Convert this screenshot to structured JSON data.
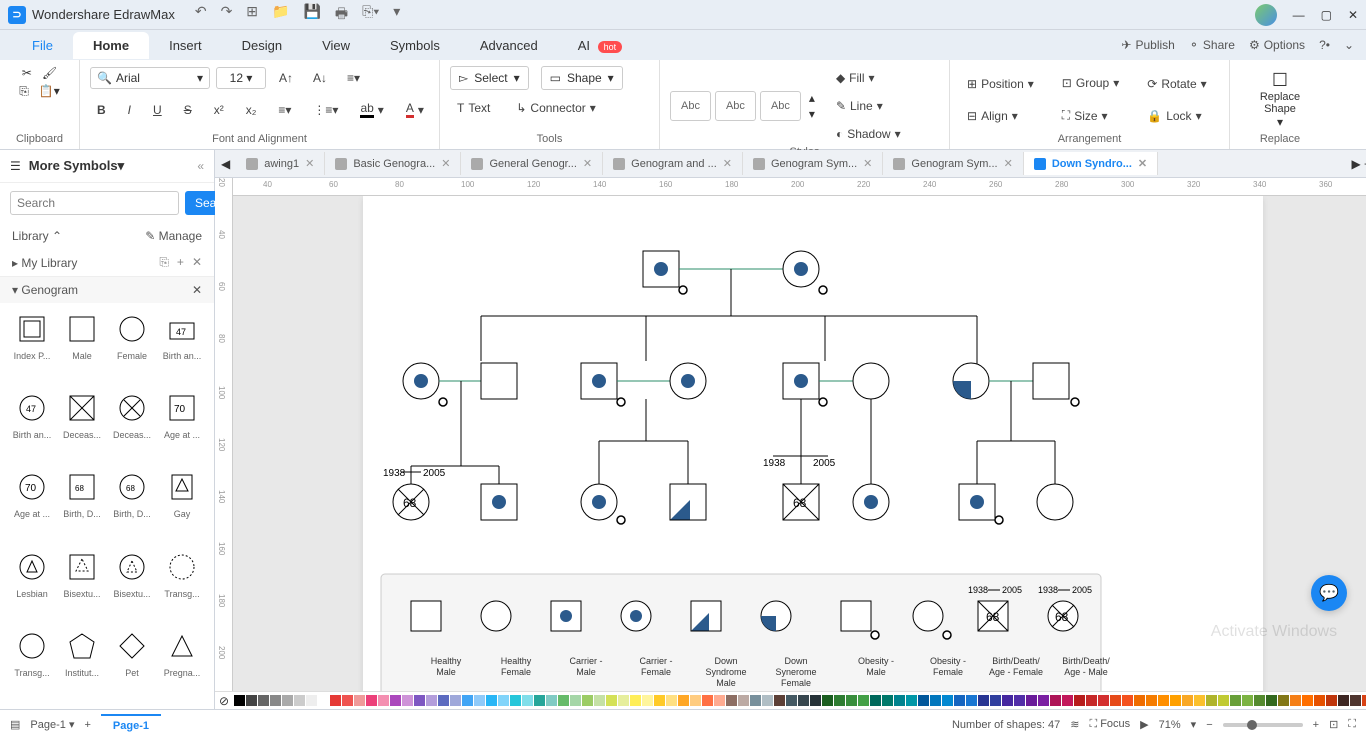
{
  "app": {
    "title": "Wondershare EdrawMax"
  },
  "menu": {
    "file": "File",
    "home": "Home",
    "insert": "Insert",
    "design": "Design",
    "view": "View",
    "symbols": "Symbols",
    "advanced": "Advanced",
    "ai": "AI",
    "hot": "hot",
    "publish": "Publish",
    "share": "Share",
    "options": "Options"
  },
  "ribbon": {
    "clipboard": "Clipboard",
    "font_align": "Font and Alignment",
    "tools": "Tools",
    "styles": "Styles",
    "arrangement": "Arrangement",
    "replace": "Replace",
    "font_name": "Arial",
    "font_size": "12",
    "select": "Select",
    "shape": "Shape",
    "text": "Text",
    "connector": "Connector",
    "abc": "Abc",
    "fill": "Fill",
    "line": "Line",
    "shadow": "Shadow",
    "position": "Position",
    "align": "Align",
    "group": "Group",
    "size": "Size",
    "rotate": "Rotate",
    "lock": "Lock",
    "replace_shape": "Replace\nShape"
  },
  "left": {
    "more_symbols": "More Symbols",
    "search_placeholder": "Search",
    "search_btn": "Search",
    "library": "Library",
    "manage": "Manage",
    "my_library": "My Library",
    "section": "Genogram",
    "symbols": [
      "Index P...",
      "Male",
      "Female",
      "Birth an...",
      "Birth an...",
      "Deceas...",
      "Deceas...",
      "Age at ...",
      "Age at ...",
      "Birth, D...",
      "Birth, D...",
      "Gay",
      "Lesbian",
      "Bisextu...",
      "Bisextu...",
      "Transg...",
      "Transg...",
      "Institut...",
      "Pet",
      "Pregna..."
    ]
  },
  "tabs": [
    "awing1",
    "Basic Genogra...",
    "General Genogr...",
    "Genogram and ...",
    "Genogram Sym...",
    "Genogram Sym...",
    "Down Syndro..."
  ],
  "ruler_h": [
    "40",
    "60",
    "80",
    "100",
    "120",
    "140",
    "160",
    "180",
    "200",
    "220",
    "240",
    "260",
    "280",
    "300",
    "320",
    "340",
    "360"
  ],
  "ruler_v": [
    "20",
    "40",
    "60",
    "80",
    "100",
    "120",
    "140",
    "160",
    "180",
    "200"
  ],
  "legend": {
    "items": [
      "Healthy\nMale",
      "Healthy\nFemale",
      "Carrier -\nMale",
      "Carrier -\nFemale",
      "Down\nSyndrome\nMale",
      "Down\nSynerome\nFemale",
      "Obesity -\nMale",
      "Obesity -\nFemale",
      "Birth/Death/\nAge - Female",
      "Birth/Death/\nAge - Male"
    ],
    "dates": [
      "1938",
      "2005",
      "1938",
      "2005"
    ],
    "age": "68"
  },
  "diagram": {
    "dates": [
      "1938",
      "2005",
      "1938",
      "2005"
    ],
    "age": "68"
  },
  "status": {
    "page1": "Page-1",
    "page_btm": "Page-1",
    "shapes": "Number of shapes: 47",
    "focus": "Focus",
    "zoom": "71%"
  },
  "watermark": "Activate Windows",
  "colors": [
    "#000",
    "#444",
    "#666",
    "#888",
    "#aaa",
    "#ccc",
    "#eee",
    "#fff",
    "#e53935",
    "#ef5350",
    "#ef9a9a",
    "#ec407a",
    "#f48fb1",
    "#ab47bc",
    "#ce93d8",
    "#7e57c2",
    "#b39ddb",
    "#5c6bc0",
    "#9fa8da",
    "#42a5f5",
    "#90caf9",
    "#29b6f6",
    "#81d4fa",
    "#26c6da",
    "#80deea",
    "#26a69a",
    "#80cbc4",
    "#66bb6a",
    "#a5d6a7",
    "#9ccc65",
    "#c5e1a5",
    "#d4e157",
    "#e6ee9c",
    "#ffee58",
    "#fff59d",
    "#ffca28",
    "#ffe082",
    "#ffa726",
    "#ffcc80",
    "#ff7043",
    "#ffab91",
    "#8d6e63",
    "#bcaaa4",
    "#78909c",
    "#b0bec5",
    "#5d4037",
    "#455a64",
    "#37474f",
    "#263238",
    "#1b5e20",
    "#2e7d32",
    "#388e3c",
    "#43a047",
    "#00695c",
    "#00796b",
    "#00838f",
    "#0097a7",
    "#01579b",
    "#0277bd",
    "#0288d1",
    "#1565c0",
    "#1976d2",
    "#283593",
    "#303f9f",
    "#4527a0",
    "#512da8",
    "#6a1b9a",
    "#7b1fa2",
    "#ad1457",
    "#c2185b",
    "#b71c1c",
    "#c62828",
    "#d32f2f",
    "#e64a19",
    "#f4511e",
    "#ef6c00",
    "#f57c00",
    "#ff8f00",
    "#ffa000",
    "#f9a825",
    "#fbc02d",
    "#afb42b",
    "#c0ca33",
    "#689f38",
    "#7cb342",
    "#558b2f",
    "#33691e",
    "#827717",
    "#f57f17",
    "#ff6f00",
    "#e65100",
    "#bf360c",
    "#3e2723",
    "#4e342e",
    "#d84315"
  ]
}
